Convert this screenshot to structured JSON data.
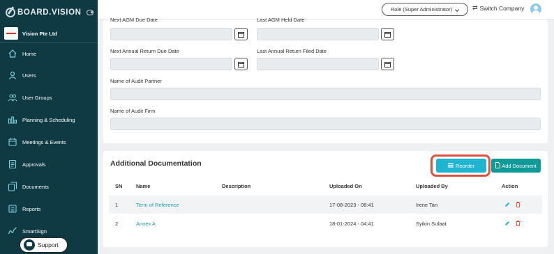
{
  "brand": {
    "name": "BOARD.VISION"
  },
  "company": {
    "name": "Vision Pte Ltd"
  },
  "nav": [
    {
      "label": "Home",
      "icon": "home-icon"
    },
    {
      "label": "Users",
      "icon": "user-icon"
    },
    {
      "label": "User Groups",
      "icon": "users-icon"
    },
    {
      "label": "Planning & Scheduling",
      "icon": "chart-icon"
    },
    {
      "label": "Meetings & Events",
      "icon": "calendar-icon"
    },
    {
      "label": "Approvals",
      "icon": "document-check-icon"
    },
    {
      "label": "Documents",
      "icon": "documents-icon"
    },
    {
      "label": "Reports",
      "icon": "report-icon"
    },
    {
      "label": "SmartSign",
      "icon": "signature-icon"
    }
  ],
  "support": {
    "label": "Support"
  },
  "topbar": {
    "role": "Role (Super Administrator)",
    "switch_company": "Switch Company"
  },
  "form": {
    "next_agm_label": "Next AGM Due Date",
    "last_agm_label": "Last AGM Held Date",
    "next_return_label": "Next Annual Return Due Date",
    "last_return_label": "Last Annual Return Filed Date",
    "audit_partner_label": "Name of Audit Partner",
    "audit_firm_label": "Name of Audit Firm"
  },
  "docs": {
    "title": "Additional Documentation",
    "reorder_label": "Reorder",
    "add_label": "Add Document",
    "columns": {
      "sn": "SN",
      "name": "Name",
      "description": "Description",
      "uploaded_on": "Uploaded On",
      "uploaded_by": "Uploaded By",
      "action": "Action"
    },
    "rows": [
      {
        "sn": "1",
        "name": "Term of Reference",
        "description": "",
        "uploaded_on": "17-08-2023 - 08:41",
        "uploaded_by": "Irene Tan"
      },
      {
        "sn": "2",
        "name": "Annex A",
        "description": "",
        "uploaded_on": "18-01-2024 - 04:41",
        "uploaded_by": "Syikin Sufaat"
      }
    ]
  },
  "colors": {
    "sidebar": "#0f3a44",
    "accent": "#1fb5d0",
    "add_button": "#0f9a9a",
    "highlight": "#e0523d",
    "link": "#1a9aa8"
  }
}
